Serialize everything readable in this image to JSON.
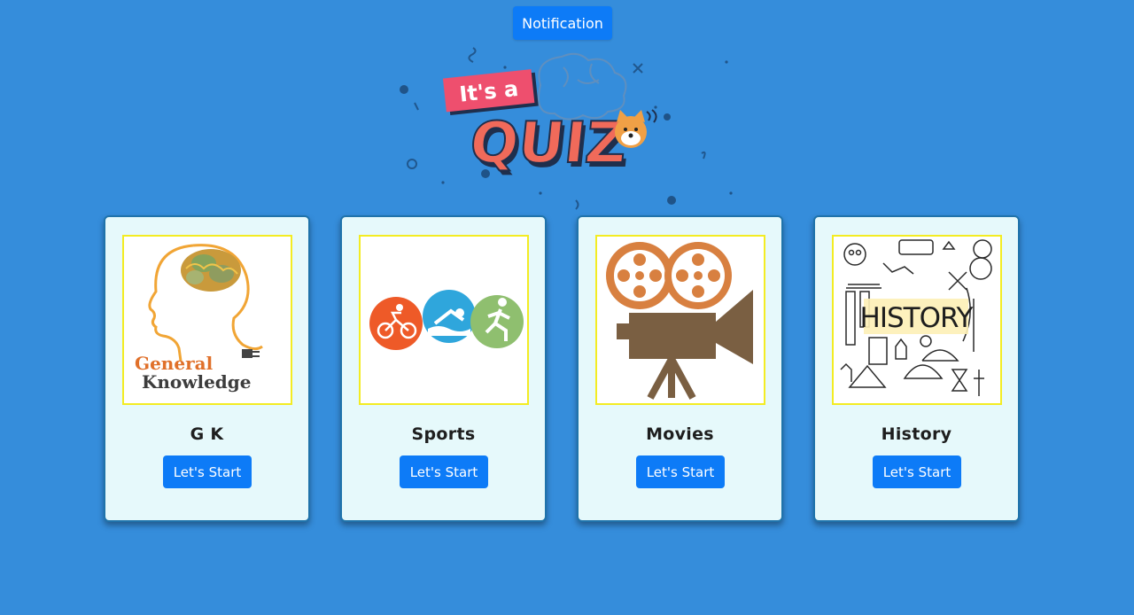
{
  "header": {
    "notification_label": "Notification"
  },
  "logo": {
    "text_top": "It's a",
    "text_main": "QUIZ"
  },
  "categories": [
    {
      "title": "G K",
      "button_label": "Let's Start",
      "image_text_1": "General",
      "image_text_2": "Knowledge",
      "icon": "brain-head-icon"
    },
    {
      "title": "Sports",
      "button_label": "Let's Start",
      "icon": "triathlon-icon"
    },
    {
      "title": "Movies",
      "button_label": "Let's Start",
      "icon": "film-projector-icon"
    },
    {
      "title": "History",
      "button_label": "Let's Start",
      "image_text": "HISTORY",
      "icon": "history-doodle-icon"
    }
  ],
  "colors": {
    "background": "#358ddb",
    "button": "#0d7bf7",
    "card": "#e6f9fb",
    "thumb_border": "#f3ec23"
  }
}
